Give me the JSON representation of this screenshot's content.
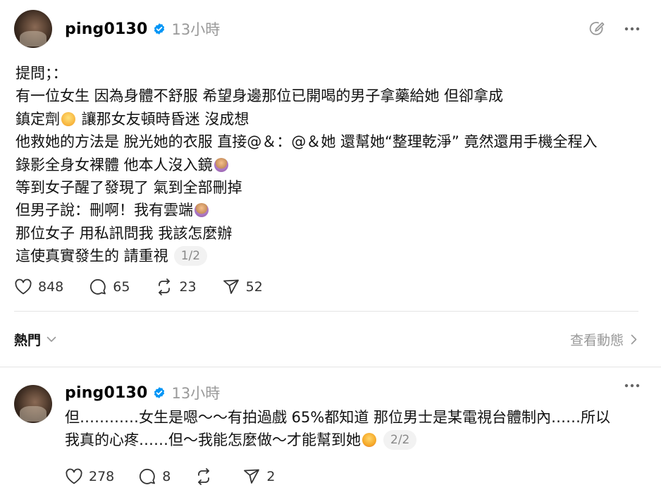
{
  "post1": {
    "username": "ping0130",
    "time": "13小時",
    "lines": [
      "提問；：",
      "有一位女生 因為身體不舒服 希望身邊那位已開喝的男子拿藥給她 但卻拿成",
      "鎮定劑",
      " 讓那女友頓時昏迷 沒成想",
      "他救她的方法是 脫光她的衣服 直接@＆：@＆她 還幫她“整理乾淨” 竟然還用手機全程入",
      "錄影全身女裸體 他本人沒入鏡",
      "等到女子醒了發現了 氣到全部刪掉",
      "但男子說：刪啊！我有雲端",
      "那位女子 用私訊問我 我該怎麼辦",
      "這使真實發生的 請重視"
    ],
    "page_indicator": "1/2",
    "likes": "848",
    "comments": "65",
    "reposts": "23",
    "shares": "52"
  },
  "sort": {
    "label": "熱門",
    "activity_label": "查看動態"
  },
  "post2": {
    "username": "ping0130",
    "time": "13小時",
    "lines": [
      "但…………女生是嗯～～有拍過戲 65%都知道 那位男士是某電視台體制內……所以",
      "我真的心疼……但～我能怎麼做～才能幫到她"
    ],
    "page_indicator": "2/2",
    "likes": "278",
    "comments": "8",
    "reposts": "",
    "shares": "2"
  },
  "icons": {
    "verified": "verified-badge-icon",
    "edit": "edit-pen-icon",
    "more": "more-dots-icon",
    "like": "heart-icon",
    "comment": "comment-bubble-icon",
    "repost": "repost-icon",
    "share": "send-icon",
    "chevron_down": "chevron-down-icon",
    "chevron_right": "chevron-right-icon"
  },
  "colors": {
    "verified_blue": "#0095f6",
    "muted_text": "#999999",
    "divider": "#e4e4e4"
  }
}
